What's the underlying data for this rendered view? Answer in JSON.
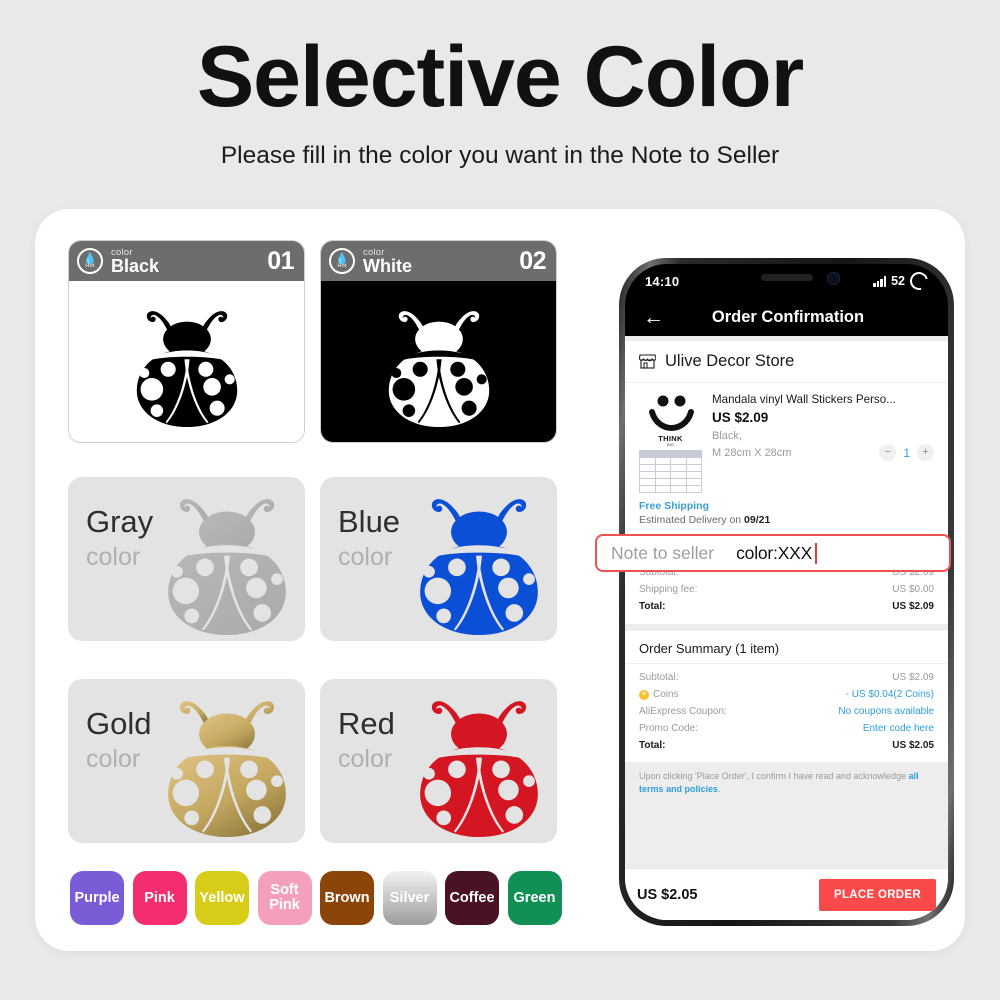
{
  "header": {
    "title": "Selective Color",
    "subtitle": "Please fill in the color you want in the Note to Seller"
  },
  "top_cards": [
    {
      "badge_flame": "flame-icon",
      "badge_label": "Hot",
      "caption": "color",
      "name": "Black",
      "number": "01",
      "bg": "#ffffff",
      "bug": "#000000"
    },
    {
      "badge_flame": "flame-icon",
      "badge_label": "Hot",
      "caption": "color",
      "name": "White",
      "number": "02",
      "bg": "#000000",
      "bug": "#ffffff"
    }
  ],
  "color_cards": [
    {
      "name": "Gray",
      "sub": "color",
      "hex": "#b3b3b3",
      "hex2": "#b3b3b3"
    },
    {
      "name": "Blue",
      "sub": "color",
      "hex": "#0a4fd6",
      "hex2": "#0a4fd6"
    },
    {
      "name": "Gold",
      "sub": "color",
      "hex": "#d9b877",
      "hex2": "#8d7a3f"
    },
    {
      "name": "Red",
      "sub": "color",
      "hex": "#d41522",
      "hex2": "#d41522"
    }
  ],
  "swatches": [
    {
      "label": "Purple",
      "hex": "#7a5cd6"
    },
    {
      "label": "Pink",
      "hex": "#f42d6e"
    },
    {
      "label": "Yellow",
      "hex": "#d7cc18"
    },
    {
      "label": "Soft Pink",
      "hex": "#f4a0bd"
    },
    {
      "label": "Brown",
      "hex": "#8b4509"
    },
    {
      "label": "Silver",
      "hex": "#c9c9c9"
    },
    {
      "label": "Coffee",
      "hex": "#4a1324"
    },
    {
      "label": "Green",
      "hex": "#109054"
    }
  ],
  "phone": {
    "status": {
      "time": "14:10",
      "signal": "signal-bars-icon",
      "battery_level": "52",
      "battery_icon": "battery-ring-icon"
    },
    "nav": {
      "back": "back-arrow-icon",
      "title": "Order Confirmation"
    },
    "store": {
      "icon": "store-icon",
      "name": "Ulive Decor Store"
    },
    "product": {
      "thumb_text": "THINK",
      "thumb_sub": "BIG",
      "title": "Mandala vinyl Wall Stickers Perso...",
      "price": "US $2.09",
      "attr_color": "Black,",
      "attr_size": "M 28cm X 28cm",
      "qty": "1",
      "minus": "−",
      "plus": "+"
    },
    "shipping": {
      "free": "Free Shipping",
      "estimate_label": "Estimated Delivery on ",
      "estimate_date": "09/21"
    },
    "note": {
      "placeholder": "Note to seller",
      "value": "color:XXX"
    },
    "totals": [
      {
        "label": "Subtotal:",
        "value": "US $2.09",
        "bold": false
      },
      {
        "label": "Shipping fee:",
        "value": "US $0.00",
        "bold": false
      },
      {
        "label": "Total:",
        "value": "US $2.09",
        "bold": true
      }
    ],
    "summary": {
      "heading": "Order Summary (1 item)",
      "rows": [
        {
          "label": "Subtotal:",
          "value": "US $2.09",
          "bold": false,
          "link": false,
          "coin": false
        },
        {
          "label": "Coins",
          "value": "- US $0.04(2 Coins)",
          "bold": false,
          "link": true,
          "coin": true
        },
        {
          "label": "AliExpress Coupon:",
          "value": "No coupons available",
          "bold": false,
          "link": true,
          "coin": false
        },
        {
          "label": "Promo Code:",
          "value": "Enter code here",
          "bold": false,
          "link": true,
          "coin": false
        },
        {
          "label": "Total:",
          "value": "US $2.05",
          "bold": true,
          "link": false,
          "coin": false
        }
      ]
    },
    "terms": {
      "text": "Upon clicking 'Place Order', I confirm I have read and acknowledge ",
      "link": "all terms and policies",
      "tail": "."
    },
    "footer": {
      "total": "US $2.05",
      "button": "PLACE ORDER"
    }
  },
  "colors": {
    "accent_red": "#fa4a4a",
    "note_border": "#ef5350",
    "link_blue": "#2f9fd9",
    "card_header": "#6d6d6d",
    "panel_bg": "#ffffff",
    "page_bg": "#e9e9e9"
  }
}
